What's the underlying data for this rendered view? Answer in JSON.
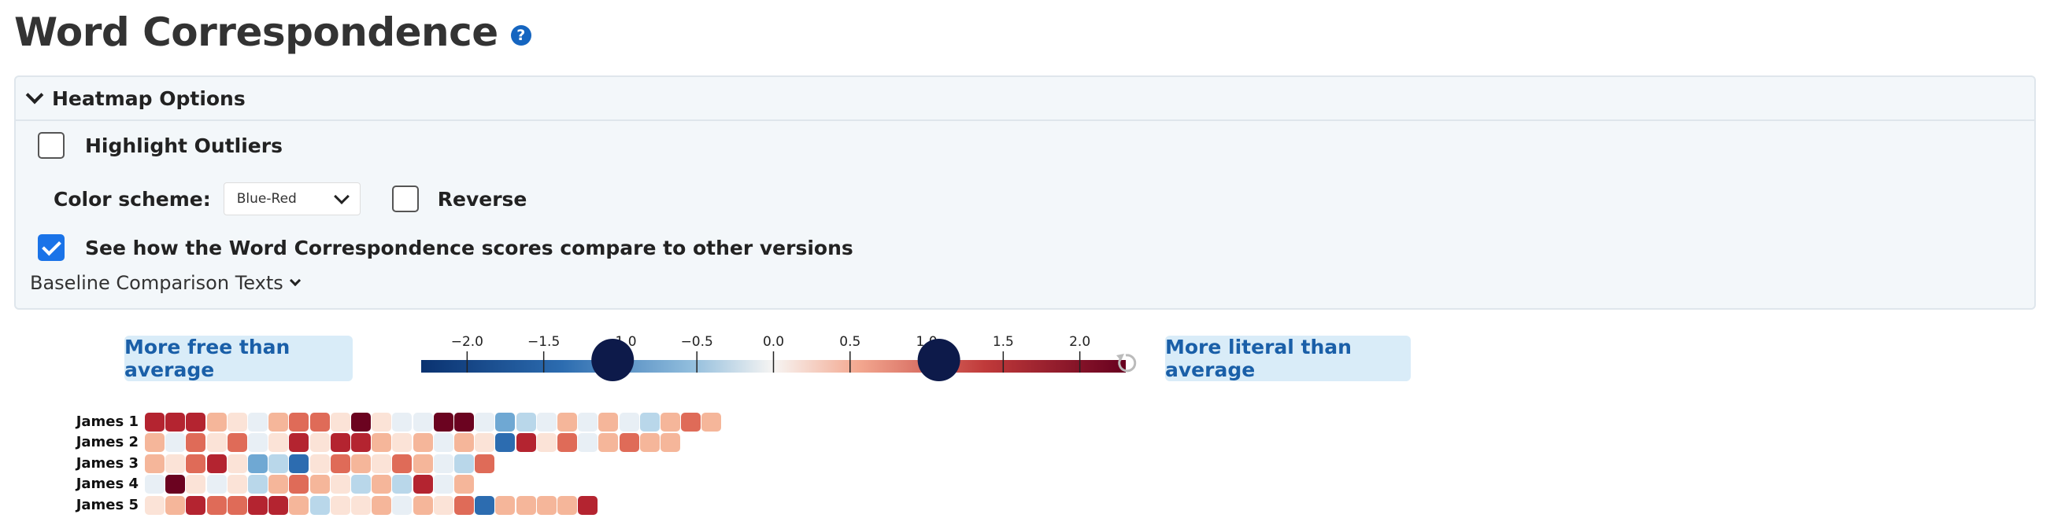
{
  "header": {
    "title": "Word Correspondence",
    "help_icon": "question-circle-icon"
  },
  "options": {
    "panel_title": "Heatmap Options",
    "highlight_outliers": {
      "label": "Highlight Outliers",
      "checked": false
    },
    "color_scheme": {
      "label": "Color scheme:",
      "value": "Blue-Red"
    },
    "reverse": {
      "label": "Reverse",
      "checked": false
    },
    "compare": {
      "label": "See how the Word Correspondence scores compare to other versions",
      "checked": true
    },
    "baseline_label": "Baseline Comparison Texts"
  },
  "legend": {
    "left_button": "More free than average",
    "right_button": "More literal than average",
    "ticks": [
      "−2.0",
      "−1.5",
      "−1.0",
      "−0.5",
      "0.0",
      "0.5",
      "1.0",
      "1.5",
      "2.0"
    ],
    "tick_values": [
      -2.0,
      -1.5,
      -1.0,
      -0.5,
      0.0,
      0.5,
      1.0,
      1.5,
      2.0
    ],
    "range": [
      -2.3,
      2.3
    ],
    "handle_low": -1.05,
    "handle_high": 1.08,
    "reset_icon": "reset-icon"
  },
  "heatmap": {
    "colors": [
      "#0a3270",
      "#2c6cb0",
      "#6fa8d3",
      "#b9d7ea",
      "#e8eff5",
      "#fbe3d7",
      "#f5b69a",
      "#df6b58",
      "#b42430",
      "#6b0320"
    ],
    "rows": [
      {
        "label": "James 1",
        "values": [
          8,
          8,
          8,
          6,
          5,
          4,
          6,
          7,
          7,
          5,
          9,
          5,
          4,
          4,
          9,
          9,
          4,
          2,
          3,
          4,
          6,
          4,
          6,
          4,
          3,
          6,
          7,
          6
        ]
      },
      {
        "label": "James 2",
        "values": [
          6,
          4,
          7,
          5,
          7,
          4,
          5,
          8,
          5,
          8,
          8,
          6,
          5,
          6,
          4,
          6,
          5,
          1,
          8,
          5,
          7,
          4,
          6,
          7,
          6,
          6
        ]
      },
      {
        "label": "James 3",
        "values": [
          6,
          5,
          7,
          8,
          5,
          2,
          3,
          1,
          5,
          7,
          6,
          5,
          7,
          6,
          4,
          3,
          7
        ]
      },
      {
        "label": "James 4",
        "values": [
          4,
          9,
          5,
          4,
          5,
          3,
          6,
          7,
          6,
          5,
          3,
          6,
          3,
          8,
          4,
          6
        ]
      },
      {
        "label": "James 5",
        "values": [
          5,
          6,
          8,
          7,
          7,
          8,
          8,
          6,
          3,
          5,
          5,
          6,
          4,
          6,
          5,
          7,
          1,
          6,
          6,
          6,
          6,
          8
        ]
      }
    ]
  }
}
